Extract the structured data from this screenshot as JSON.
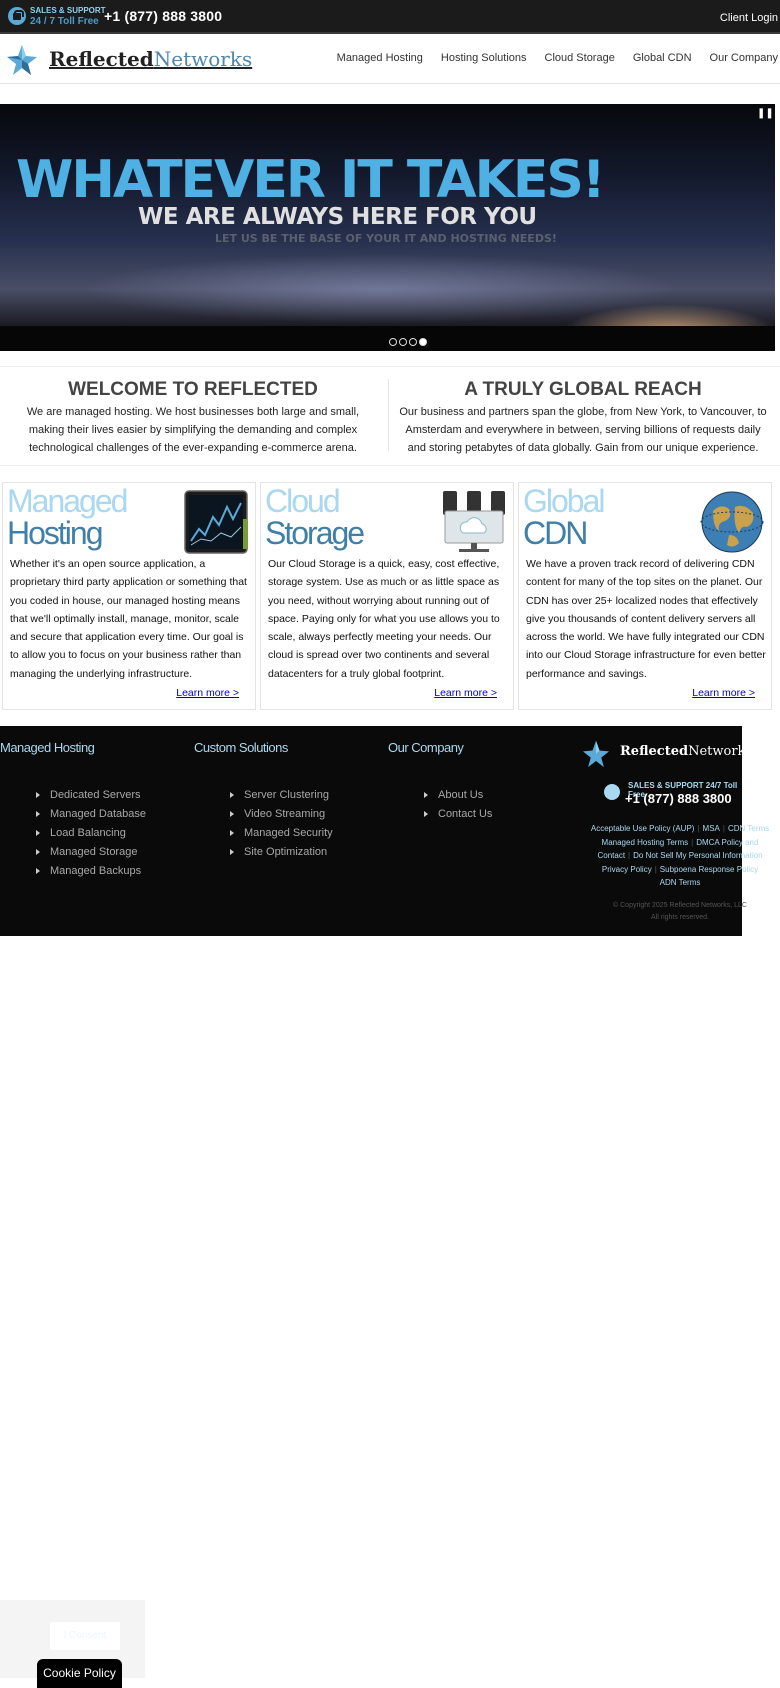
{
  "topbar": {
    "support_top": "SALES & SUPPORT",
    "support_bottom": "24 / 7 Toll Free",
    "phone": "+1 (877) 888 3800",
    "client_login": "Client Login"
  },
  "header": {
    "logo_bold": "Reflected",
    "logo_light": "Networks",
    "nav": [
      "Managed Hosting",
      "Hosting Solutions",
      "Cloud Storage",
      "Global CDN",
      "Our Company"
    ]
  },
  "hero": {
    "title": "WHATEVER IT TAKES!",
    "subtitle": "WE ARE ALWAYS HERE  FOR YOU",
    "tagline": "LET US BE THE BASE OF YOUR IT AND HOSTING NEEDS!",
    "slide_count": 4,
    "active_slide": 4
  },
  "intro": {
    "left_title": "WELCOME TO REFLECTED",
    "left_text": "We are managed hosting. We host businesses both large and small, making their lives easier by simplifying the demanding and complex technological challenges of the ever-expanding e-commerce arena.",
    "right_title": "A TRULY GLOBAL REACH",
    "right_text": "Our business and partners span the globe, from New York, to Vancouver, to Amsterdam and everywhere in between, serving billions of requests daily and storing petabytes of data globally. Gain from our unique experience."
  },
  "features": [
    {
      "title_light": "Managed",
      "title_dark": "Hosting",
      "icon": "monitor-chart-icon",
      "text": "Whether it's an open source application, a proprietary third party application or something that you coded in house, our managed hosting means that we'll optimally install, manage, monitor, scale and secure that application every time. Our goal is to allow you to focus on your business rather than managing the underlying infrastructure.",
      "link": "Learn more >"
    },
    {
      "title_light": "Cloud",
      "title_dark": "Storage",
      "icon": "cloud-servers-icon",
      "text": "Our Cloud Storage is a quick, easy, cost effective, storage system. Use as much or as little space as you need, without worrying about running out of space. Paying only for what you use allows you to scale, always perfectly meeting your needs. Our cloud is spread over two continents and several datacenters for a truly global footprint.",
      "link": "Learn more >"
    },
    {
      "title_light": "Global",
      "title_dark": "CDN",
      "icon": "globe-icon",
      "text": "We have a proven track record of delivering CDN content for many of the top sites on the planet. Our CDN has over 25+ localized nodes that effectively give you thousands of content delivery servers all across the world. We have fully integrated our CDN into our Cloud Storage infrastructure for even better performance and savings.",
      "link": "Learn more >"
    }
  ],
  "footer": {
    "columns": [
      {
        "title": "Managed Hosting",
        "items": [
          "Dedicated Servers",
          "Managed Database",
          "Load Balancing",
          "Managed Storage",
          "Managed Backups"
        ]
      },
      {
        "title": "Custom Solutions",
        "items": [
          "Server Clustering",
          "Video Streaming",
          "Managed Security",
          "Site Optimization"
        ]
      },
      {
        "title": "Our Company",
        "items": [
          "About Us",
          "Contact Us"
        ]
      }
    ],
    "logo_bold": "Reflected",
    "logo_light": "Networks",
    "support": "SALES & SUPPORT  24/7 Toll Free",
    "phone": "+1 (877) 888 3800",
    "links": [
      "Acceptable Use Policy (AUP)",
      "MSA",
      "CDN Terms",
      "Managed Hosting Terms",
      "DMCA Policy and",
      "Contact",
      "Do Not Sell My Personal Information",
      "Privacy Policy",
      "Subpoena Response Policy",
      "ADN Terms"
    ],
    "copyright": "© Copyright 2025 Reflected Networks, LLC",
    "rights": "All rights reserved."
  },
  "cookie": {
    "consent": "I Consent",
    "policy": "Cookie Policy"
  },
  "colors": {
    "accent_light": "#a9d8f0",
    "accent_dark": "#3f7fa8",
    "topbar": "#1b1b1b",
    "footer": "#0a0a0a"
  }
}
